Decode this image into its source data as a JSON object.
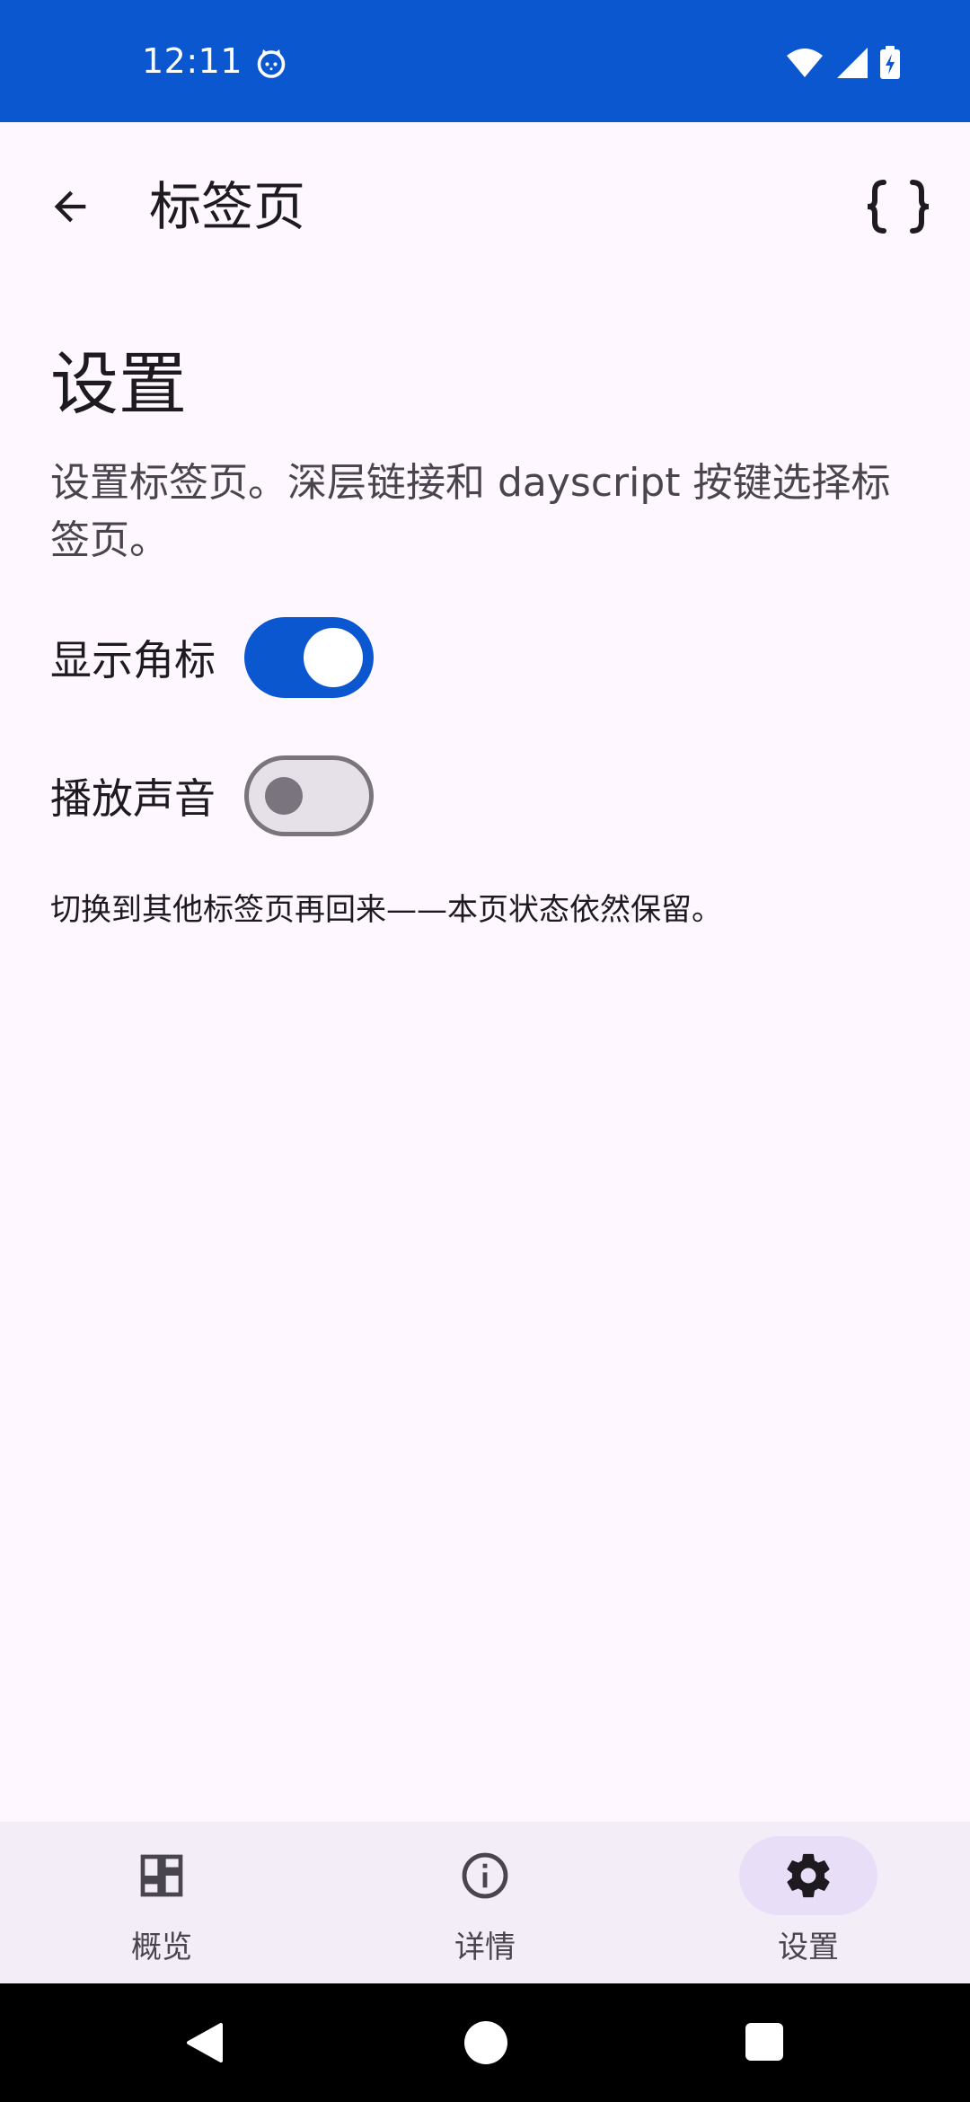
{
  "status_bar": {
    "time": "12:11",
    "background": "#0B57D0"
  },
  "app_bar": {
    "title": "标签页",
    "back_icon": "arrow-back-icon",
    "action_icon": "code-braces-icon"
  },
  "settings": {
    "title": "设置",
    "description": "设置标签页。深层链接和 dayscript 按键选择标签页。",
    "toggles": [
      {
        "label": "显示角标",
        "checked": true
      },
      {
        "label": "播放声音",
        "checked": false
      }
    ],
    "footnote": "切换到其他标签页再回来——本页状态依然保留。"
  },
  "bottom_nav": {
    "items": [
      {
        "label": "概览",
        "icon": "dashboard-icon",
        "active": false
      },
      {
        "label": "详情",
        "icon": "info-icon",
        "active": false
      },
      {
        "label": "设置",
        "icon": "gear-icon",
        "active": true
      }
    ]
  },
  "colors": {
    "accent": "#0B57D0",
    "surface": "#FEF7FF",
    "nav_surface": "#F3EDF7",
    "nav_indicator": "#E8DEF8"
  }
}
